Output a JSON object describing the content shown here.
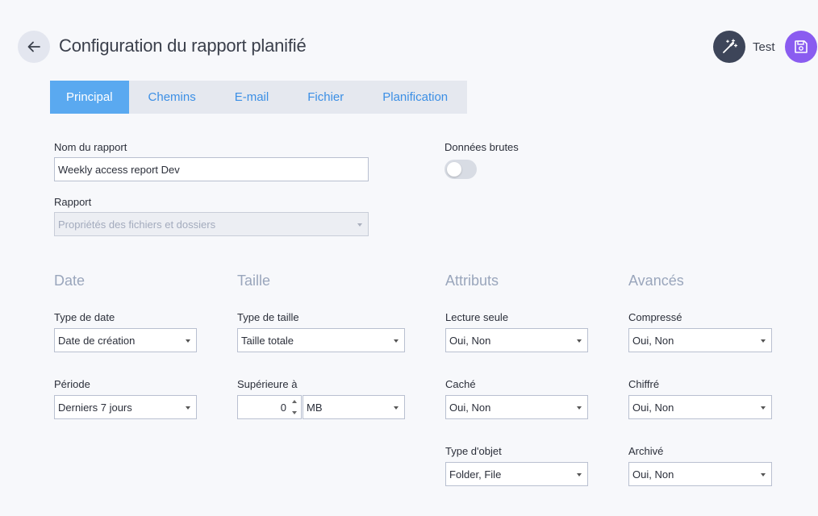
{
  "header": {
    "title": "Configuration du rapport planifié",
    "test_label": "Test"
  },
  "tabs": [
    {
      "label": "Principal",
      "active": true
    },
    {
      "label": "Chemins",
      "active": false
    },
    {
      "label": "E-mail",
      "active": false
    },
    {
      "label": "Fichier",
      "active": false
    },
    {
      "label": "Planification",
      "active": false
    }
  ],
  "form": {
    "report_name_label": "Nom du rapport",
    "report_name_value": "Weekly access report Dev",
    "report_label": "Rapport",
    "report_value": "Propriétés des fichiers et dossiers",
    "raw_data_label": "Données brutes",
    "raw_data_on": false
  },
  "sections": {
    "date": "Date",
    "size": "Taille",
    "attributes": "Attributs",
    "advanced": "Avancés"
  },
  "fields": {
    "date_type_label": "Type de date",
    "date_type_value": "Date de création",
    "period_label": "Période",
    "period_value": "Derniers 7 jours",
    "size_type_label": "Type de taille",
    "size_type_value": "Taille totale",
    "greater_than_label": "Supérieure à",
    "greater_than_value": "0",
    "unit_value": "MB",
    "readonly_label": "Lecture seule",
    "readonly_value": "Oui, Non",
    "hidden_label": "Caché",
    "hidden_value": "Oui, Non",
    "object_type_label": "Type d'objet",
    "object_type_value": "Folder, File",
    "compressed_label": "Compressé",
    "compressed_value": "Oui, Non",
    "encrypted_label": "Chiffré",
    "encrypted_value": "Oui, Non",
    "archived_label": "Archivé",
    "archived_value": "Oui, Non"
  },
  "colors": {
    "accent": "#5aa9f0",
    "save": "#8a5cf0",
    "test": "#3d4559"
  },
  "icons": {
    "back": "arrow-left-icon",
    "test": "magic-wand-icon",
    "save": "floppy-disk-icon"
  }
}
